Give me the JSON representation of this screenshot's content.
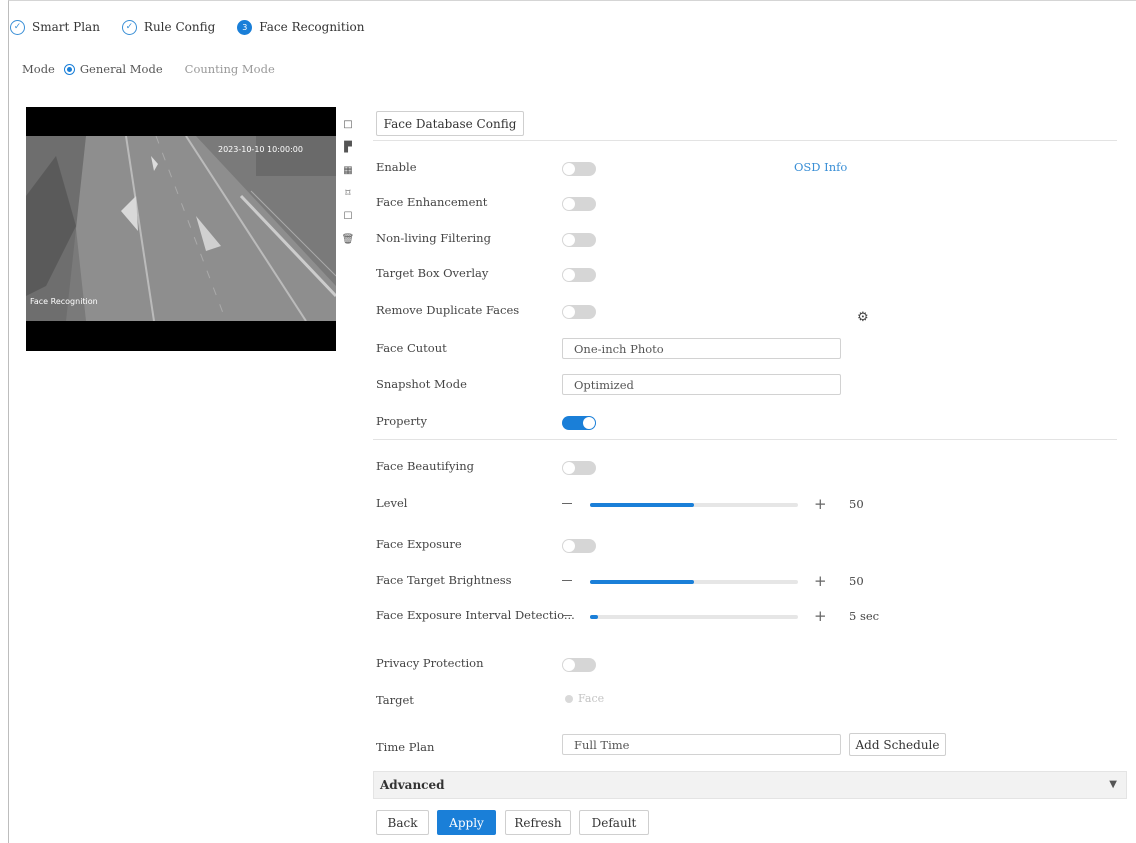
{
  "steps": [
    {
      "label": "Smart Plan",
      "icon": "check-circle-icon",
      "marker": "✓"
    },
    {
      "label": "Rule Config",
      "icon": "check-circle-icon",
      "marker": "✓"
    },
    {
      "label": "Face Recognition",
      "icon": "step-number-icon",
      "marker": "3"
    }
  ],
  "mode": {
    "label": "Mode",
    "options": [
      "General Mode",
      "Counting Mode"
    ],
    "selected": "General Mode"
  },
  "video": {
    "timestamp": "2023-10-10 10:00:00",
    "channel_label": "Face Recognition"
  },
  "toolbar_icons": [
    "zoom-icon",
    "snapshot-icon",
    "grid-icon",
    "draw-rule-icon",
    "draw-box-icon",
    "delete-icon"
  ],
  "face_db_button": "Face Database Config",
  "osd_info": "OSD Info",
  "rows": {
    "enable": {
      "label": "Enable",
      "on": false
    },
    "face_enhancement": {
      "label": "Face Enhancement",
      "on": false
    },
    "non_living": {
      "label": "Non-living Filtering",
      "on": false
    },
    "target_box": {
      "label": "Target Box Overlay",
      "on": false
    },
    "remove_dup": {
      "label": "Remove Duplicate Faces",
      "on": false
    },
    "face_cutout": {
      "label": "Face Cutout",
      "value": "One-inch Photo"
    },
    "snapshot_mode": {
      "label": "Snapshot Mode",
      "value": "Optimized"
    },
    "property": {
      "label": "Property",
      "on": true
    },
    "face_beautifying": {
      "label": "Face Beautifying",
      "on": false
    },
    "level": {
      "label": "Level",
      "value": "50",
      "fraction": 0.5
    },
    "face_exposure": {
      "label": "Face Exposure",
      "on": false
    },
    "face_target_brightness": {
      "label": "Face Target Brightness",
      "value": "50",
      "fraction": 0.5
    },
    "face_exposure_interval": {
      "label": "Face Exposure Interval Detectio...",
      "value": "5 sec",
      "fraction": 0.04
    },
    "privacy_protection": {
      "label": "Privacy Protection",
      "on": false
    },
    "target": {
      "label": "Target",
      "option": "Face"
    },
    "time_plan": {
      "label": "Time Plan",
      "value": "Full Time"
    }
  },
  "add_schedule": "Add Schedule",
  "advanced": "Advanced",
  "buttons": {
    "back": "Back",
    "apply": "Apply",
    "refresh": "Refresh",
    "default": "Default"
  },
  "colors": {
    "accent": "#1a7fd8",
    "toggle_off": "#d6d6d6"
  }
}
